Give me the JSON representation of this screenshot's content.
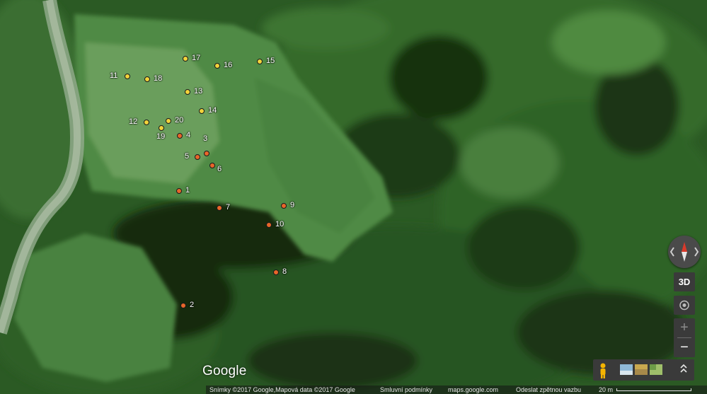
{
  "map": {
    "type": "satellite",
    "markers": [
      {
        "label": "1",
        "color": "#e8662a"
      },
      {
        "label": "2",
        "color": "#e8662a"
      },
      {
        "label": "3",
        "color": "#e8662a"
      },
      {
        "label": "4",
        "color": "#e8662a"
      },
      {
        "label": "5",
        "color": "#e8662a"
      },
      {
        "label": "6",
        "color": "#e8662a"
      },
      {
        "label": "7",
        "color": "#e8662a"
      },
      {
        "label": "8",
        "color": "#e8662a"
      },
      {
        "label": "9",
        "color": "#e8662a"
      },
      {
        "label": "10",
        "color": "#e8662a"
      },
      {
        "label": "11",
        "color": "#f2d33b"
      },
      {
        "label": "12",
        "color": "#f2d33b"
      },
      {
        "label": "13",
        "color": "#f2d33b"
      },
      {
        "label": "14",
        "color": "#f2d33b"
      },
      {
        "label": "15",
        "color": "#f2d33b"
      },
      {
        "label": "16",
        "color": "#f2d33b"
      },
      {
        "label": "17",
        "color": "#f2d33b"
      },
      {
        "label": "18",
        "color": "#f2d33b"
      },
      {
        "label": "19",
        "color": "#f2d33b"
      },
      {
        "label": "20",
        "color": "#f2d33b"
      }
    ]
  },
  "branding": {
    "logo": "Google"
  },
  "controls": {
    "compass_icon": "compass-icon",
    "btn_3d": "3D",
    "zoom_in": "+",
    "zoom_out": "−",
    "pegman_icon": "pegman-icon",
    "expand_icon": "chevron-up-icon"
  },
  "footer": {
    "attribution": "Snímky ©2017 Google,Mapová data ©2017 Google",
    "terms": "Smluvní podmínky",
    "site": "maps.google.com",
    "feedback": "Odeslat zpětnou vazbu",
    "scale": "20 m"
  },
  "colors": {
    "marker_yellow": "#f2d33b",
    "marker_orange": "#e8662a",
    "control_bg": "#3a3a3a"
  }
}
